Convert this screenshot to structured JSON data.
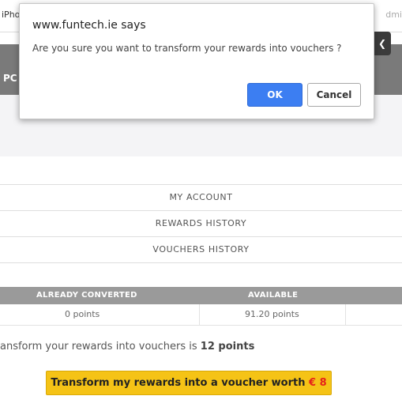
{
  "topbar": {
    "left_text": "iPho",
    "right_text": "dmi"
  },
  "header": {
    "label": "PC",
    "corner_icon": "chevron-icon"
  },
  "menu": {
    "items": [
      {
        "label": "MY ACCOUNT"
      },
      {
        "label": "REWARDS HISTORY"
      },
      {
        "label": "VOUCHERS HISTORY"
      }
    ]
  },
  "points_table": {
    "headers": [
      "ALREADY CONVERTED",
      "AVAILABLE"
    ],
    "values": [
      "0 points",
      "91.20 points"
    ]
  },
  "minimum": {
    "text": "ansform your rewards into vouchers is ",
    "amount": "12 points"
  },
  "transform_button": {
    "label": "Transform my rewards into a voucher worth ",
    "amount": "€ 8"
  },
  "dialog": {
    "title": "www.funtech.ie says",
    "message": "Are you sure you want to transform your rewards into vouchers ?",
    "ok_label": "OK",
    "cancel_label": "Cancel"
  },
  "colors": {
    "ok_button": "#3c7ef2",
    "transform_button": "#f5c316",
    "amount_red": "#e5231b",
    "table_header": "#9a9a9a"
  }
}
